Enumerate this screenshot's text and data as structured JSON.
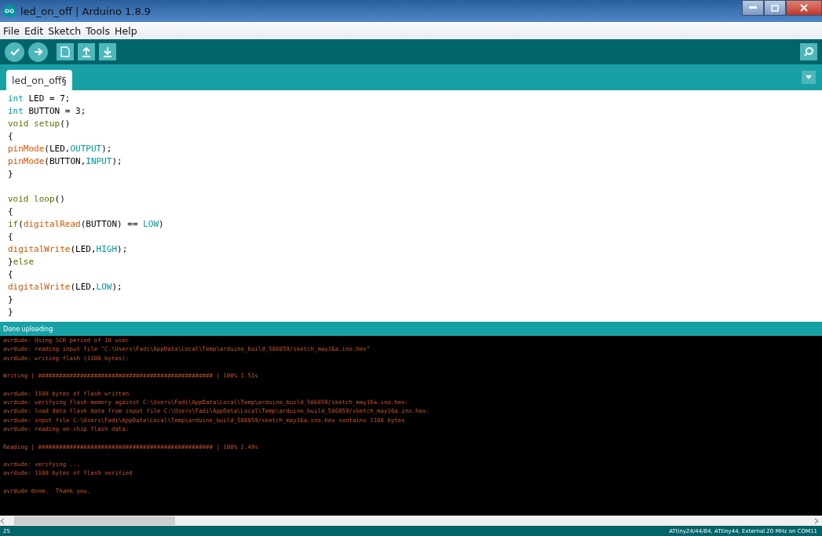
{
  "window": {
    "title": "led_on_off | Arduino 1.8.9"
  },
  "menu": [
    "File",
    "Edit",
    "Sketch",
    "Tools",
    "Help"
  ],
  "toolbar": [
    {
      "kind": "verify"
    },
    {
      "kind": "upload"
    },
    {
      "kind": "new"
    },
    {
      "kind": "open"
    },
    {
      "kind": "save"
    }
  ],
  "tabs": [
    {
      "label": "led_on_off§",
      "selected": true
    }
  ],
  "editor": {
    "lines": [
      {
        "tokens": [
          {
            "text": "int",
            "kind": "type"
          },
          {
            "text": " LED = 7;",
            "kind": "plain"
          }
        ]
      },
      {
        "tokens": [
          {
            "text": "int",
            "kind": "type"
          },
          {
            "text": " BUTTON = 3;",
            "kind": "plain"
          }
        ]
      },
      {
        "tokens": [
          {
            "text": "void setup",
            "kind": "struct"
          },
          {
            "text": "()",
            "kind": "plain"
          }
        ]
      },
      {
        "tokens": [
          {
            "text": "{",
            "kind": "plain"
          }
        ]
      },
      {
        "tokens": [
          {
            "text": "pinMode",
            "kind": "func"
          },
          {
            "text": "(LED,",
            "kind": "plain"
          },
          {
            "text": "OUTPUT",
            "kind": "const"
          },
          {
            "text": ");",
            "kind": "plain"
          }
        ]
      },
      {
        "tokens": [
          {
            "text": "pinMode",
            "kind": "func"
          },
          {
            "text": "(BUTTON,",
            "kind": "plain"
          },
          {
            "text": "INPUT",
            "kind": "const"
          },
          {
            "text": ");",
            "kind": "plain"
          }
        ]
      },
      {
        "tokens": [
          {
            "text": "}",
            "kind": "plain"
          }
        ]
      },
      {
        "gap_before": true,
        "tokens": [
          {
            "text": "void loop",
            "kind": "struct"
          },
          {
            "text": "()",
            "kind": "plain"
          }
        ]
      },
      {
        "tokens": [
          {
            "text": "{",
            "kind": "plain"
          }
        ]
      },
      {
        "tokens": [
          {
            "text": "if",
            "kind": "struct"
          },
          {
            "text": "(",
            "kind": "plain"
          },
          {
            "text": "digitalRead",
            "kind": "func"
          },
          {
            "text": "(BUTTON) == ",
            "kind": "plain"
          },
          {
            "text": "LOW",
            "kind": "const"
          },
          {
            "text": ")",
            "kind": "plain"
          }
        ]
      },
      {
        "tokens": [
          {
            "text": "{",
            "kind": "plain"
          }
        ]
      },
      {
        "tokens": [
          {
            "text": "digitalWrite",
            "kind": "func"
          },
          {
            "text": "(LED,",
            "kind": "plain"
          },
          {
            "text": "HIGH",
            "kind": "const"
          },
          {
            "text": ");",
            "kind": "plain"
          }
        ]
      },
      {
        "tokens": [
          {
            "text": "}",
            "kind": "plain"
          },
          {
            "text": "else",
            "kind": "struct"
          }
        ]
      },
      {
        "tokens": [
          {
            "text": "{",
            "kind": "plain"
          }
        ]
      },
      {
        "tokens": [
          {
            "text": "digitalWrite",
            "kind": "func"
          },
          {
            "text": "(LED,",
            "kind": "plain"
          },
          {
            "text": "LOW",
            "kind": "const"
          },
          {
            "text": ");",
            "kind": "plain"
          }
        ]
      },
      {
        "tokens": [
          {
            "text": "}",
            "kind": "plain"
          }
        ]
      },
      {
        "tokens": [
          {
            "text": "}",
            "kind": "plain"
          }
        ]
      }
    ]
  },
  "status": "Done uploading",
  "console": {
    "blocks": [
      [
        "avrdude: Using SCK period of 10 usec",
        "avrdude: reading input file \"C:\\Users\\Fadi\\AppData\\Local\\Temp\\arduino_build_586059/sketch_may16a.ino.hex\"",
        "avrdude: writing flash (1108 bytes):"
      ],
      [
        "Writing | ################################################## | 100% 1.51s"
      ],
      [
        "avrdude: 1108 bytes of flash written",
        "avrdude: verifying flash memory against C:\\Users\\Fadi\\AppData\\Local\\Temp\\arduino_build_586059/sketch_may16a.ino.hex:",
        "avrdude: load data flash data from input file C:\\Users\\Fadi\\AppData\\Local\\Temp\\arduino_build_586059/sketch_may16a.ino.hex:",
        "avrdude: input file C:\\Users\\Fadi\\AppData\\Local\\Temp\\arduino_build_586059/sketch_may16a.ino.hex contains 1108 bytes",
        "avrdude: reading on-chip flash data:"
      ],
      [
        "Reading | ################################################## | 100% 2.49s"
      ],
      [
        "avrdude: verifying ...",
        "avrdude: 1108 bytes of flash verified"
      ],
      [
        "avrdude done.  Thank you."
      ]
    ]
  },
  "footer": {
    "line": "25",
    "board": "ATtiny24/44/84, ATtiny44, External 20 MHz on COM11"
  }
}
